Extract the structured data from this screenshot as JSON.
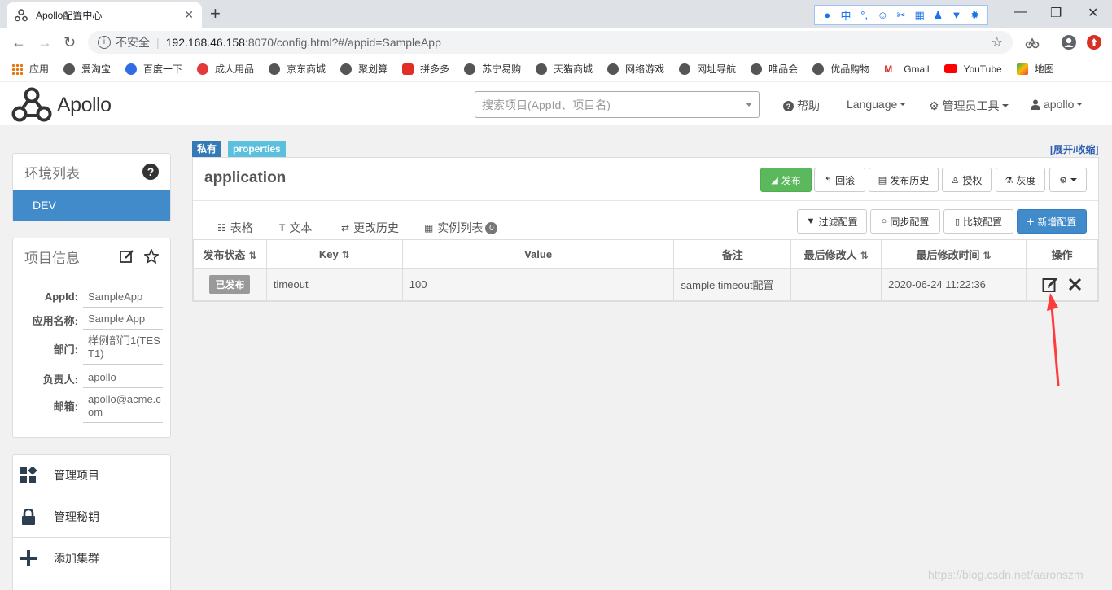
{
  "browser": {
    "tab_title": "Apollo配置中心",
    "url_security": "不安全",
    "url_host": "192.168.46.158",
    "url_rest": ":8070/config.html?#/appid=SampleApp",
    "bookmarks": [
      "应用",
      "爱淘宝",
      "百度一下",
      "成人用品",
      "京东商城",
      "聚划算",
      "拼多多",
      "苏宁易购",
      "天猫商城",
      "网络游戏",
      "网址导航",
      "唯品会",
      "优品购物",
      "Gmail",
      "YouTube",
      "地图"
    ],
    "ime_label": "中"
  },
  "header": {
    "logo_text": "Apollo",
    "search_placeholder": "搜索项目(AppId、项目名)",
    "help": "帮助",
    "language": "Language",
    "admin_tools": "管理员工具",
    "user": "apollo"
  },
  "sidebar": {
    "env_title": "环境列表",
    "envs": [
      "DEV"
    ],
    "info_title": "项目信息",
    "info": [
      {
        "k": "AppId:",
        "v": "SampleApp"
      },
      {
        "k": "应用名称:",
        "v": "Sample App"
      },
      {
        "k": "部门:",
        "v": "样例部门1(TEST1)"
      },
      {
        "k": "负责人:",
        "v": "apollo"
      },
      {
        "k": "邮箱:",
        "v": "apollo@acme.com"
      }
    ],
    "menu": [
      "管理项目",
      "管理秘钥",
      "添加集群"
    ]
  },
  "main": {
    "labels": {
      "private": "私有",
      "format": "properties"
    },
    "expand_toggle": "[展开/收缩]",
    "namespace": "application",
    "actions": {
      "publish": "发布",
      "rollback": "回滚",
      "history": "发布历史",
      "grant": "授权",
      "gray": "灰度"
    },
    "tabs": {
      "table": "表格",
      "text": "文本",
      "changes": "更改历史",
      "instances": "实例列表",
      "instances_count": "0"
    },
    "tools": {
      "filter": "过滤配置",
      "sync": "同步配置",
      "compare": "比较配置",
      "add": "新增配置"
    },
    "columns": [
      "发布状态",
      "Key",
      "Value",
      "备注",
      "最后修改人",
      "最后修改时间",
      "操作"
    ],
    "rows": [
      {
        "status": "已发布",
        "key": "timeout",
        "value": "100",
        "comment": "sample timeout配置",
        "modifier": "",
        "time": "2020-06-24 11:22:36"
      }
    ]
  },
  "watermark": "https://blog.csdn.net/aaronszm",
  "colors": {
    "primary": "#428bca",
    "success": "#5cb85c",
    "info_label": "#5bc0de",
    "annotation_arrow": "#ff3b3b"
  }
}
